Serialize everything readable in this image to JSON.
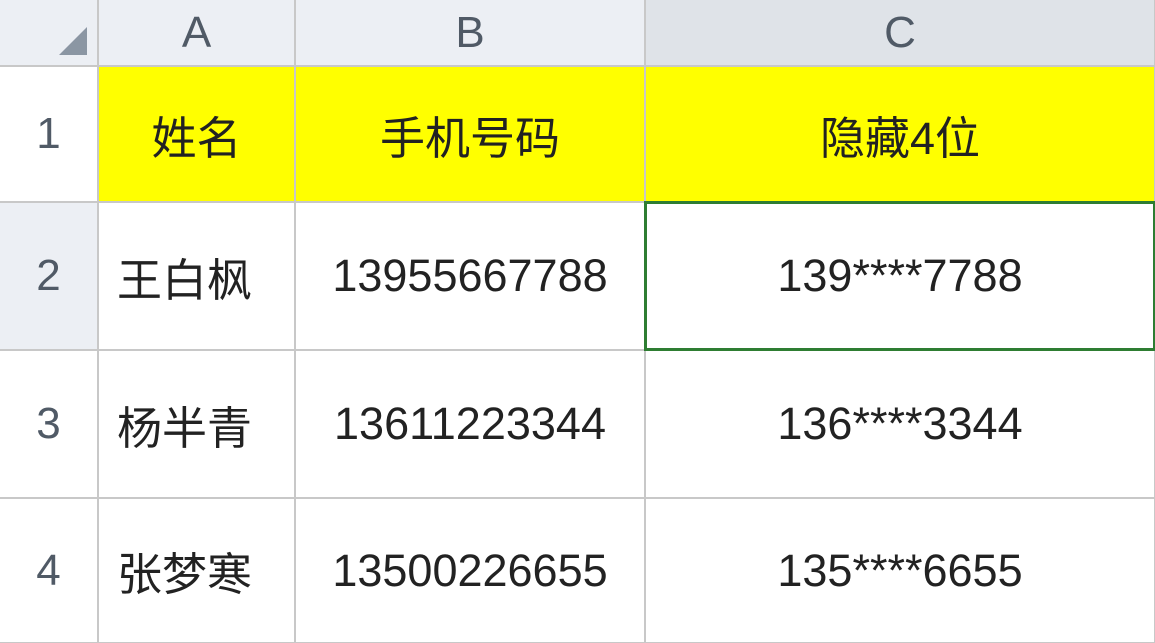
{
  "columns": [
    "A",
    "B",
    "C"
  ],
  "rows": [
    "1",
    "2",
    "3",
    "4"
  ],
  "headers": {
    "A": "姓名",
    "B": "手机号码",
    "C": "隐藏4位"
  },
  "data": [
    {
      "name": "王白枫",
      "phone": "13955667788",
      "masked": "139****7788"
    },
    {
      "name": "杨半青",
      "phone": "13611223344",
      "masked": "136****3344"
    },
    {
      "name": "张梦寒",
      "phone": "13500226655",
      "masked": "135****6655"
    }
  ],
  "activeCell": "C2"
}
